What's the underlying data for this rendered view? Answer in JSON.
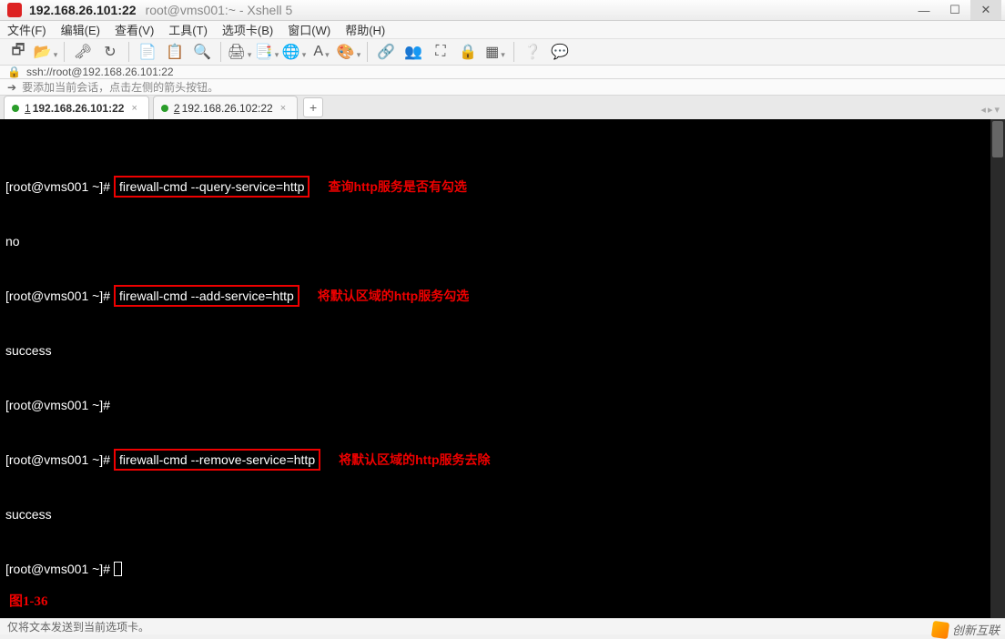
{
  "title": {
    "primary": "192.168.26.101:22",
    "secondary": "root@vms001:~ - Xshell 5"
  },
  "window_buttons": {
    "min": "—",
    "max": "☐",
    "close": "✕"
  },
  "menu": {
    "file": "文件(F)",
    "edit": "编辑(E)",
    "view": "查看(V)",
    "tools": "工具(T)",
    "tab": "选项卡(B)",
    "window": "窗口(W)",
    "help": "帮助(H)"
  },
  "toolbar_icons": {
    "new": "🗗",
    "open": "📂",
    "disconnect": "🗝",
    "reconnect": "↻",
    "copy": "📄",
    "paste": "📋",
    "find": "🔍",
    "print": "🖨",
    "props": "📑",
    "globe": "🌐",
    "font": "A",
    "color": "🎨",
    "link": "🔗",
    "users": "👥",
    "fullscreen": "⛶",
    "lock": "🔒",
    "tile": "▦",
    "help": "❔",
    "feedback": "💬"
  },
  "address": {
    "lock_icon": "🔒",
    "url": "ssh://root@192.168.26.101:22"
  },
  "hint": {
    "arrow": "➔",
    "text": "要添加当前会话，点击左侧的箭头按钮。"
  },
  "tabs": {
    "t1": {
      "num": "1",
      "label": "192.168.26.101:22"
    },
    "t2": {
      "num": "2",
      "label": "192.168.26.102:22"
    },
    "close": "×",
    "add": "+",
    "left": "◂",
    "right": "▸",
    "dd": "▾"
  },
  "term": {
    "p1": "[root@vms001 ~]#",
    "cmd1": "firewall-cmd --query-service=http",
    "ann1": "查询http服务是否有勾选",
    "out1": "no",
    "p2": "[root@vms001 ~]#",
    "cmd2": "firewall-cmd --add-service=http",
    "ann2": "将默认区域的http服务勾选",
    "out2": "success",
    "p3": "[root@vms001 ~]#",
    "p4": "[root@vms001 ~]#",
    "cmd3": "firewall-cmd --remove-service=http",
    "ann3": "将默认区域的http服务去除",
    "out3": "success",
    "p5": "[root@vms001 ~]#",
    "figure": "图1-36"
  },
  "status": "仅将文本发送到当前选项卡。",
  "watermark": "创新互联"
}
